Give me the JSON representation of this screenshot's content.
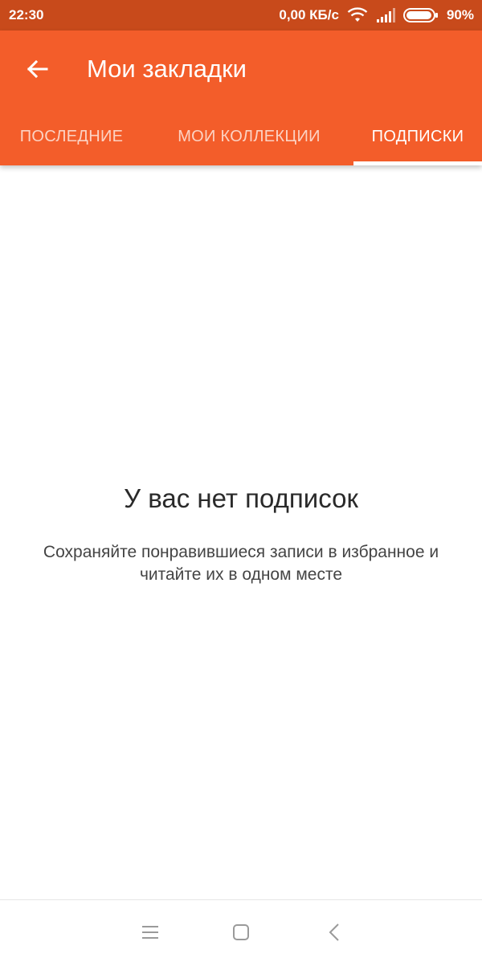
{
  "status_bar": {
    "time": "22:30",
    "network_speed": "0,00 КБ/с",
    "battery_percent": "90%",
    "icons": [
      "wifi-icon",
      "signal-icon",
      "battery-icon"
    ]
  },
  "app_bar": {
    "title": "Мои закладки",
    "back_icon": "arrow-left-icon",
    "background_color": "#f35d2a",
    "status_color": "#c84a1b"
  },
  "tabs": [
    {
      "label": "ПОСЛЕДНИЕ",
      "active": false
    },
    {
      "label": "МОИ КОЛЛЕКЦИИ",
      "active": false
    },
    {
      "label": "ПОДПИСКИ",
      "active": true
    }
  ],
  "empty_state": {
    "title": "У вас нет подписок",
    "subtitle_line1": "Сохраняйте понравившиеся записи в избранное и",
    "subtitle_line2": "читайте их в одном месте"
  },
  "nav_bar": {
    "icons": [
      "menu-icon",
      "home-square-icon",
      "back-chevron-icon"
    ]
  }
}
